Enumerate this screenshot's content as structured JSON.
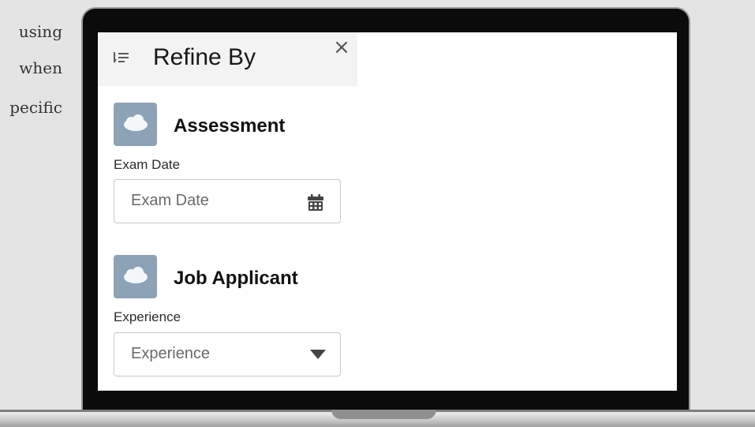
{
  "background_text": {
    "line1": "using",
    "line2": "when",
    "line3": "pecific"
  },
  "panel": {
    "title": "Refine By",
    "close_glyph": "×",
    "header_icon": "filter-sort-icon",
    "sections": [
      {
        "object": "Assessment",
        "icon": "cloud-icon",
        "field_label": "Exam Date",
        "placeholder": "Exam Date",
        "control_icon": "calendar-icon"
      },
      {
        "object": "Job Applicant",
        "icon": "cloud-icon",
        "field_label": "Experience",
        "placeholder": "Experience",
        "control_icon": "caret-down-icon"
      }
    ]
  },
  "colors": {
    "page_bg": "#e4e4e4",
    "header_bg": "#f3f3f3",
    "object_icon_bg": "#8ea2b7",
    "laptop_bezel": "#0b0b0b"
  }
}
